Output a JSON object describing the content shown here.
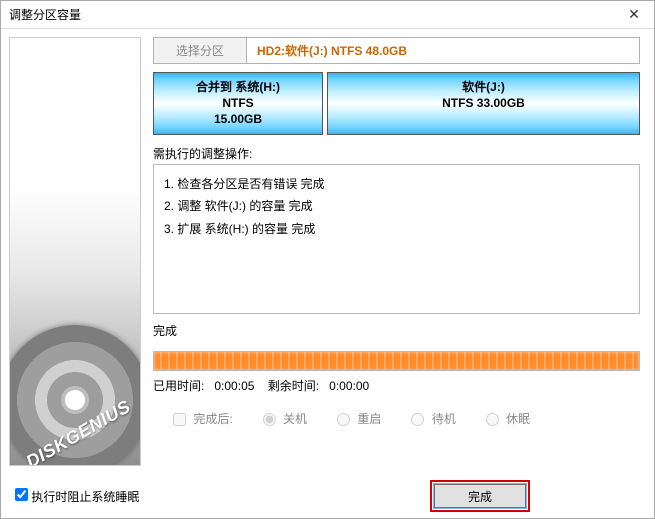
{
  "title": "调整分区容量",
  "close_glyph": "✕",
  "tab_label": "选择分区",
  "disk_info": "HD2:软件(J:) NTFS 48.0GB",
  "hdd_brand": "DISKGENIUS",
  "partitions": {
    "a": {
      "line1": "合并到 系统(H:)",
      "line2": "NTFS",
      "line3": "15.00GB"
    },
    "b": {
      "line1": "软件(J:)",
      "line2": "NTFS 33.00GB"
    }
  },
  "ops_label": "需执行的调整操作:",
  "ops": {
    "s1": "1. 检查各分区是否有错误    完成",
    "s2": "2. 调整 软件(J:) 的容量    完成",
    "s3": "3. 扩展 系统(H:) 的容量    完成"
  },
  "status": "完成",
  "time_label": "已用时间:",
  "time_used": "0:00:05",
  "remain_label": "剩余时间:",
  "time_remain": "0:00:00",
  "after": {
    "label": "完成后:",
    "shutdown": "关机",
    "reboot": "重启",
    "standby": "待机",
    "hibernate": "休眠"
  },
  "prevent_sleep": "执行时阻止系统睡眠",
  "finish": "完成"
}
